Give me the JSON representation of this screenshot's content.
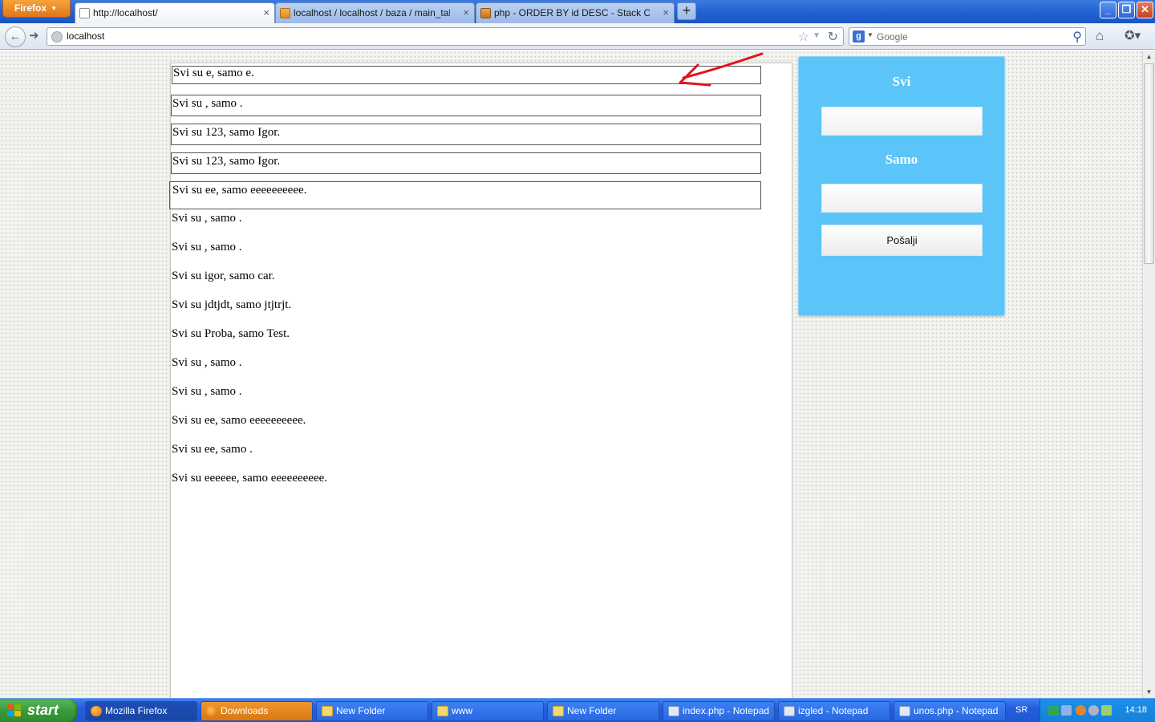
{
  "browser": {
    "app_button": "Firefox",
    "tabs": [
      {
        "label": "http://localhost/",
        "active": true
      },
      {
        "label": "localhost / localhost / baza / main_table |...",
        "active": false
      },
      {
        "label": "php - ORDER BY id DESC - Stack Overflow",
        "active": false
      }
    ],
    "new_tab": "+",
    "url": "localhost",
    "search_placeholder": "Google"
  },
  "page": {
    "entries": [
      {
        "text": "Svi su e, samo e.",
        "boxed": true
      },
      {
        "text": "Svi su , samo .",
        "boxed": true
      },
      {
        "text": "Svi su 123, samo Igor.",
        "boxed": true
      },
      {
        "text": "Svi su 123, samo Igor.",
        "boxed": true
      },
      {
        "text": "Svi su ee, samo eeeeeeeeee.",
        "boxed": true
      },
      {
        "text": "Svi su , samo .",
        "boxed": false
      },
      {
        "text": "Svi su , samo .",
        "boxed": false
      },
      {
        "text": "Svi su igor, samo car.",
        "boxed": false
      },
      {
        "text": "Svi su jdtjdt, samo jtjtrjt.",
        "boxed": false
      },
      {
        "text": "Svi su Proba, samo Test.",
        "boxed": false
      },
      {
        "text": "Svi su , samo .",
        "boxed": false
      },
      {
        "text": "Svi su , samo .",
        "boxed": false
      },
      {
        "text": "Svi su ee, samo eeeeeeeeee.",
        "boxed": false
      },
      {
        "text": "Svi su ee, samo .",
        "boxed": false
      },
      {
        "text": "Svi su eeeeee, samo eeeeeeeeee.",
        "boxed": false
      }
    ],
    "form": {
      "label_svi": "Svi",
      "label_samo": "Samo",
      "svi_value": "",
      "samo_value": "",
      "submit_label": "Pošalji"
    },
    "annotation_color": "#e0141b",
    "panel_color": "#5bc4f8"
  },
  "taskbar": {
    "start_label": "start",
    "tasks": [
      {
        "label": "Mozilla Firefox",
        "icon": "firefox-icon",
        "state": "active"
      },
      {
        "label": "Downloads",
        "icon": "firefox-icon",
        "state": "highlight"
      },
      {
        "label": "New Folder",
        "icon": "folder-icon",
        "state": "normal"
      },
      {
        "label": "www",
        "icon": "folder-icon",
        "state": "normal"
      },
      {
        "label": "New Folder",
        "icon": "folder-icon",
        "state": "normal"
      },
      {
        "label": "index.php - Notepad",
        "icon": "notepad-icon",
        "state": "normal"
      },
      {
        "label": "izgled - Notepad",
        "icon": "notepad-icon",
        "state": "normal"
      },
      {
        "label": "unos.php - Notepad",
        "icon": "notepad-icon",
        "state": "normal"
      }
    ],
    "language": "SR",
    "clock": "14:18"
  }
}
